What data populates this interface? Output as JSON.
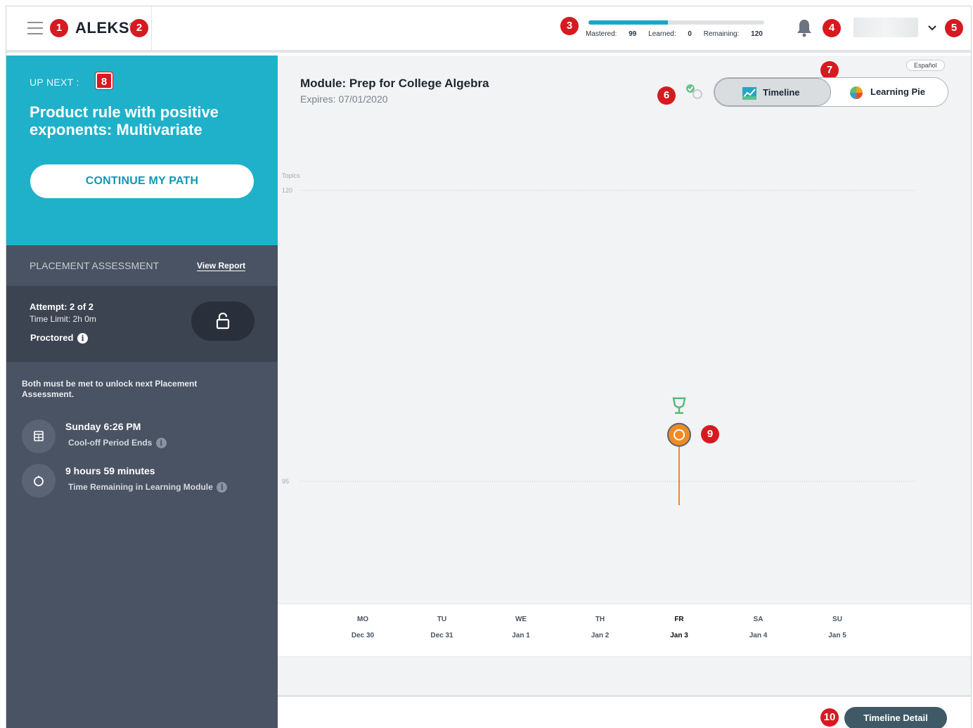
{
  "header": {
    "logo_text": "ALEKS",
    "logo_mark": "®",
    "progress": {
      "mastered_label": "Mastered:",
      "mastered": "99",
      "learned_label": "Learned:",
      "learned": "0",
      "remaining_label": "Remaining:",
      "remaining": "120",
      "fill_fraction": 0.45
    }
  },
  "callouts": [
    "1",
    "2",
    "3",
    "4",
    "5",
    "6",
    "7",
    "8",
    "9",
    "10"
  ],
  "sidebar": {
    "up_next_label": "UP NEXT :",
    "up_next_title": "Product rule with positive exponents: Multivariate",
    "continue_label": "CONTINUE MY PATH",
    "placement_title": "PLACEMENT ASSESSMENT",
    "view_report": "View Report",
    "attempt": "Attempt: 2 of 2",
    "time_limit": "Time Limit: 2h 0m",
    "proctored": "Proctored",
    "unlock_note": "Both must be met to unlock next Placement Assessment.",
    "requirements": [
      {
        "title": "Sunday 6:26 PM",
        "subtitle": "Cool-off Period Ends",
        "icon": "calendar-icon"
      },
      {
        "title": "9 hours 59 minutes",
        "subtitle": "Time Remaining in Learning Module",
        "icon": "timer-icon"
      }
    ]
  },
  "main": {
    "espanol": "Español",
    "module_title": "Module: Prep for College Algebra",
    "expires": "Expires: 07/01/2020",
    "toggle": {
      "timeline": "Timeline",
      "pie": "Learning Pie"
    },
    "timeline_detail": "Timeline Detail"
  },
  "colors": {
    "accent": "#1fb1c9",
    "sidebar": "#4a5363",
    "progress_line": "#f08a24",
    "goal": "#56b878"
  },
  "chart_data": {
    "type": "line",
    "ylabel": "Topics",
    "ylim": [
      95,
      120
    ],
    "y_ticks": [
      120,
      95
    ],
    "categories": [
      {
        "day": "MO",
        "date": "Dec 30"
      },
      {
        "day": "TU",
        "date": "Dec 31"
      },
      {
        "day": "WE",
        "date": "Jan 1"
      },
      {
        "day": "TH",
        "date": "Jan 2"
      },
      {
        "day": "FR",
        "date": "Jan 3"
      },
      {
        "day": "SA",
        "date": "Jan 4"
      },
      {
        "day": "SU",
        "date": "Jan 5"
      }
    ],
    "current_index": 4,
    "current_value": 99,
    "goal_marker_index": 4
  }
}
